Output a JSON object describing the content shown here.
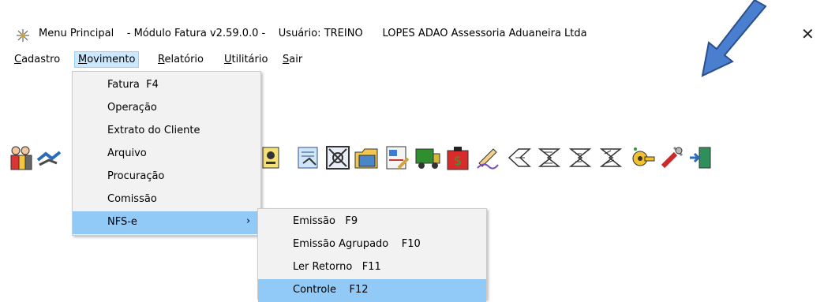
{
  "title": {
    "app": "Menu Principal",
    "module": "- Módulo Fatura v2.59.0.0 -",
    "user": "Usuário: TREINO",
    "company": "LOPES ADAO Assessoria Aduaneira Ltda",
    "close_glyph": "✕"
  },
  "menubar": {
    "items": [
      {
        "first": "C",
        "rest": "adastro"
      },
      {
        "first": "M",
        "rest": "ovimento"
      },
      {
        "first": "R",
        "rest": "elatório"
      },
      {
        "first": "U",
        "rest": "tilitário"
      },
      {
        "first": "S",
        "rest": "air"
      }
    ]
  },
  "toolbar": {
    "icons": [
      "users-icon",
      "handshake-icon",
      "invoice-icon",
      "document-icon",
      "chart-icon",
      "folder-icon",
      "report-icon",
      "truck-icon",
      "money-bag-icon",
      "signature-icon",
      "nfe-icon",
      "nfe-group-icon",
      "nfe-return-icon",
      "nfe-control-icon",
      "key-icon",
      "tools-icon",
      "exit-icon"
    ]
  },
  "movimento_menu": {
    "items": [
      {
        "label": "Fatura  F4"
      },
      {
        "label": "Operação"
      },
      {
        "label": "Extrato do Cliente"
      },
      {
        "label": "Arquivo"
      },
      {
        "label": "Procuração"
      },
      {
        "label": "Comissão"
      },
      {
        "label": "NFS-e",
        "arrow": "›"
      }
    ]
  },
  "nfse_submenu": {
    "items": [
      {
        "label": "Emissão   F9"
      },
      {
        "label": "Emissão Agrupado    F10"
      },
      {
        "label": "Ler Retorno   F11"
      },
      {
        "label": "Controle    F12"
      }
    ]
  },
  "colors": {
    "highlight": "#91c9f7",
    "menu_bg": "#f2f2f2",
    "annotation_arrow": "#4a7fd0"
  }
}
